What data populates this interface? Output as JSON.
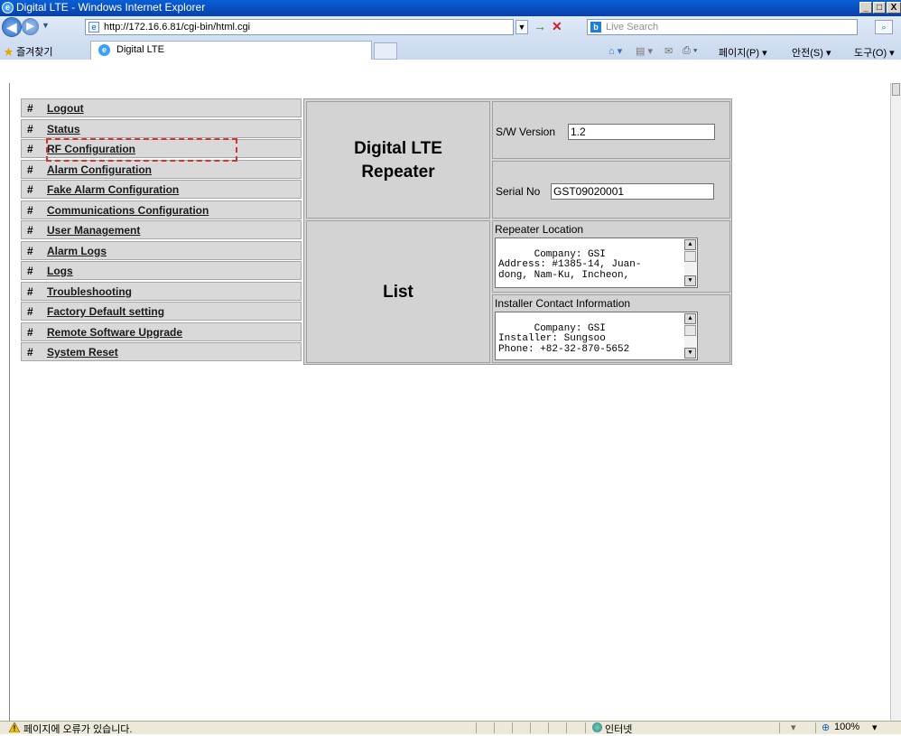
{
  "window": {
    "title": "Digital LTE - Windows Internet Explorer",
    "controls": [
      "_",
      "□",
      "X"
    ]
  },
  "address_bar": {
    "url": "http://172.16.6.81/cgi-bin/html.cgi",
    "search_placeholder": "Live Search"
  },
  "favorites": {
    "label": "즐겨찾기",
    "tab_title": "Digital LTE"
  },
  "command_bar": {
    "page": "페이지(P) ▾",
    "safety": "안전(S) ▾",
    "tools": "도구(O) ▾"
  },
  "menu": {
    "bullet": "#",
    "items": [
      {
        "label": "Logout"
      },
      {
        "label": "Status"
      },
      {
        "label": "RF Configuration"
      },
      {
        "label": "Alarm Configuration"
      },
      {
        "label": "Fake Alarm Configuration"
      },
      {
        "label": "Communications Configuration"
      },
      {
        "label": "User Management"
      },
      {
        "label": "Alarm Logs"
      },
      {
        "label": "Logs"
      },
      {
        "label": "Troubleshooting"
      },
      {
        "label": "Factory Default setting"
      },
      {
        "label": "Remote Software Upgrade"
      },
      {
        "label": "System Reset"
      }
    ]
  },
  "header_panel": {
    "title_line1": "Digital LTE",
    "title_line2": "Repeater",
    "list_title": "List"
  },
  "info": {
    "sw_version_label": "S/W Version",
    "sw_version_value": "1.2",
    "serial_label": "Serial No",
    "serial_value": "GST09020001",
    "location_label": "Repeater Location",
    "location_text": "Company: GSI\nAddress: #1385-14, Juan-\ndong, Nam-Ku, Incheon,",
    "installer_label": "Installer Contact Information",
    "installer_text": "Company: GSI\nInstaller: Sungsoo\nPhone: +82-32-870-5652"
  },
  "status_bar": {
    "message": "페이지에 오류가 있습니다.",
    "zone": "인터넷",
    "zoom": "100%"
  },
  "colors": {
    "titlebar": "#0a5fd6",
    "highlight": "#d9312c",
    "panel": "#d3d3d3"
  }
}
